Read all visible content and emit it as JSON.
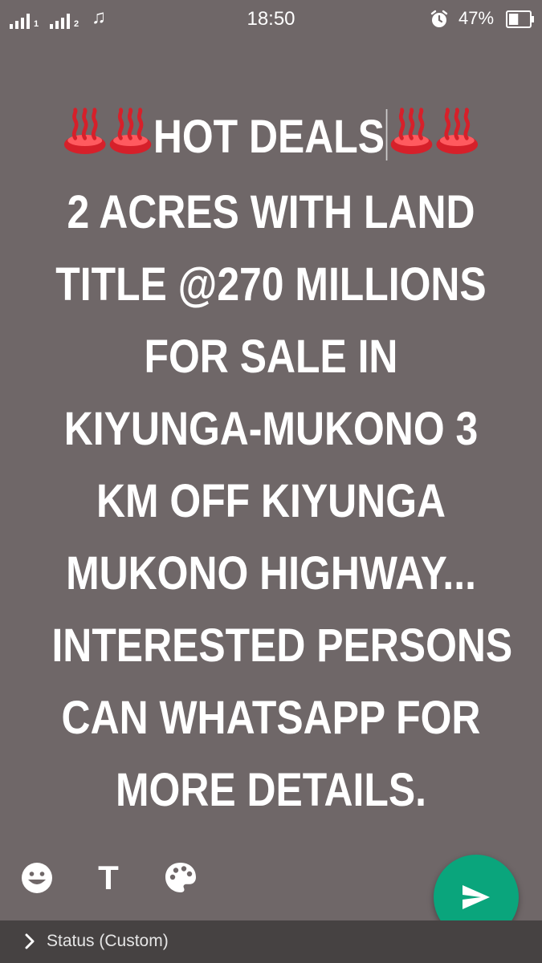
{
  "status_bar": {
    "sim1": "1",
    "sim2": "2",
    "music_glyph": "♫",
    "time": "18:50",
    "battery_percent": "47%",
    "battery_level": 0.47
  },
  "message": {
    "line1_text": "HOT DEALS",
    "lines": [
      "2 ACRES WITH LAND",
      "TITLE @270 MILLIONS",
      "FOR SALE IN",
      "KIYUNGA-MUKONO 3",
      "KM OFF KIYUNGA",
      "MUKONO HIGHWAY...",
      "INTERESTED PERSONS",
      "CAN WHATSAPP FOR",
      "MORE DETAILS."
    ]
  },
  "toolbar": {
    "text_tool_label": "T"
  },
  "footer": {
    "label": "Status (Custom)"
  },
  "icons": {
    "hot_spring": "hot-springs-emoji",
    "emoji": "smiley-icon",
    "palette": "palette-icon",
    "send": "send-icon"
  },
  "colors": {
    "background": "#6f6768",
    "accent": "#0aa57c",
    "text": "#ffffff",
    "emoji_red": "#d6202a"
  }
}
